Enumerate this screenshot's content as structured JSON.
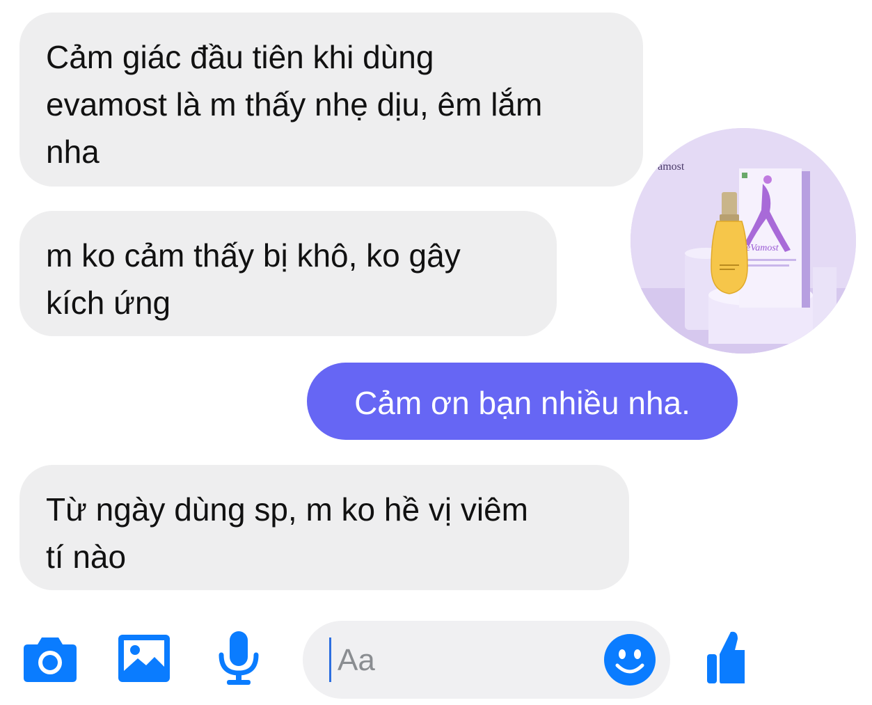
{
  "messages": [
    {
      "direction": "incoming",
      "lines": [
        "Cảm giác đầu tiên khi dùng",
        "evamost là m thấy nhẹ dịu, êm lắm",
        "nha"
      ]
    },
    {
      "direction": "incoming",
      "lines": [
        "m ko cảm thấy bị khô, ko gây",
        "kích ứng"
      ]
    },
    {
      "direction": "outgoing",
      "text": "Cảm ơn bạn nhiều nha."
    },
    {
      "direction": "incoming",
      "lines": [
        "Từ ngày dùng sp, m ko hề vị viêm",
        "tí nào"
      ]
    }
  ],
  "photo": {
    "brand_top": "evamost",
    "box_brand": "eVamost"
  },
  "composer": {
    "placeholder": "Aa",
    "icons": [
      "camera-icon",
      "gallery-icon",
      "microphone-icon",
      "emoji-icon",
      "like-icon"
    ]
  },
  "colors": {
    "accent": "#0a7cff",
    "outgoing_bubble": "#6666f4",
    "incoming_bubble": "#eeeeef"
  }
}
